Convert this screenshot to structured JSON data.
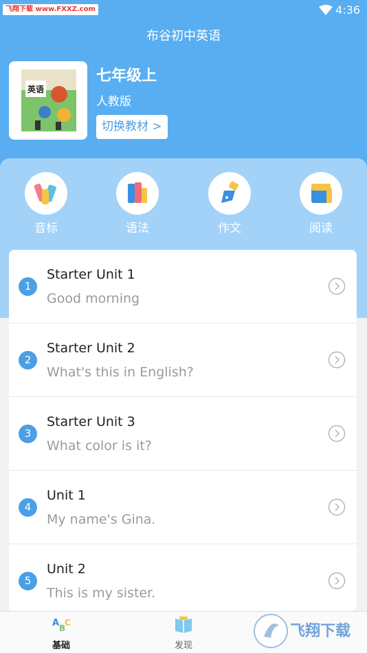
{
  "status_bar": {
    "watermark": "飞翔下载 www.FXXZ.com",
    "time": "4:36"
  },
  "header": {
    "title": "布谷初中英语"
  },
  "book": {
    "grade": "七年级上",
    "edition": "人教版",
    "switch_label": "切换教材 >",
    "cover_text": "英语"
  },
  "features": [
    {
      "label": "音标",
      "icon": "crayons-icon"
    },
    {
      "label": "语法",
      "icon": "books-icon"
    },
    {
      "label": "作文",
      "icon": "pen-nib-icon"
    },
    {
      "label": "阅读",
      "icon": "notebook-icon"
    }
  ],
  "units": [
    {
      "number": "1",
      "title": "Starter Unit 1",
      "subtitle": "Good morning"
    },
    {
      "number": "2",
      "title": "Starter Unit 2",
      "subtitle": "What's this in English?"
    },
    {
      "number": "3",
      "title": "Starter Unit 3",
      "subtitle": "What color is it?"
    },
    {
      "number": "4",
      "title": "Unit 1",
      "subtitle": "My name's Gina."
    },
    {
      "number": "5",
      "title": "Unit 2",
      "subtitle": "This is my sister."
    }
  ],
  "tabs": [
    {
      "label": "基础",
      "icon": "abc-icon",
      "active": true
    },
    {
      "label": "发现",
      "icon": "book-open-icon",
      "active": false
    }
  ],
  "brand_watermark": "飞翔下载",
  "colors": {
    "primary": "#58aef1",
    "accent": "#4a9fe6"
  }
}
